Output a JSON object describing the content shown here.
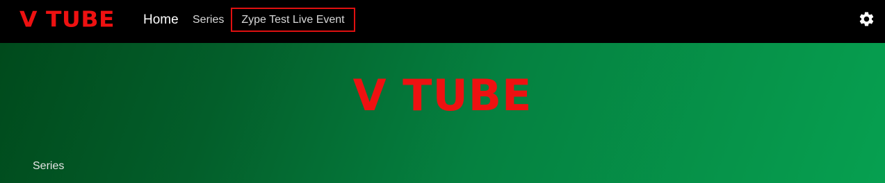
{
  "header": {
    "logo_text": "V TUBE",
    "nav": {
      "home": "Home",
      "series": "Series",
      "live_event": "Zype Test Live Event"
    },
    "settings_icon": "gear-icon"
  },
  "hero": {
    "title": "V TUBE",
    "section_label": "Series"
  },
  "colors": {
    "brand_red": "#ee1111",
    "header_bg": "#000000",
    "hero_gradient_start": "#004a1c",
    "hero_gradient_end": "#06a050"
  }
}
